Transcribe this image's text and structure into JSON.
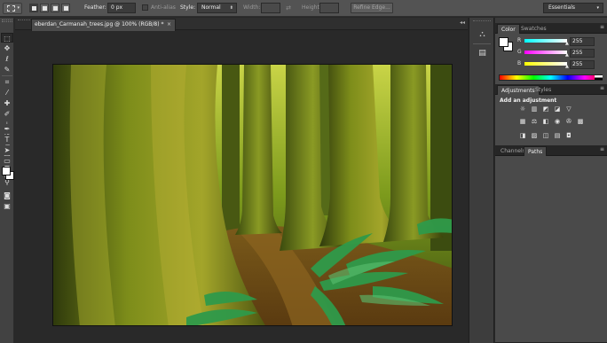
{
  "options_bar": {
    "feather_label": "Feather:",
    "feather_value": "0 px",
    "antialias_label": "Anti-alias",
    "style_label": "Style:",
    "style_value": "Normal",
    "width_label": "Width:",
    "height_label": "Height:",
    "refine_edge_label": "Refine Edge...",
    "workspace_value": "Essentials"
  },
  "document": {
    "tab_title": "eberdan_Carmanah_trees.jpg @ 100% (RGB/8) *",
    "tab_close": "×"
  },
  "color_panel": {
    "tabs": [
      "Color",
      "Swatches"
    ],
    "channels": [
      {
        "label": "R",
        "value": "255"
      },
      {
        "label": "G",
        "value": "255"
      },
      {
        "label": "B",
        "value": "255"
      }
    ],
    "foreground_color": "#ffffff",
    "background_color": "#ffffff"
  },
  "adjustments_panel": {
    "tabs": [
      "Adjustments",
      "Styles"
    ],
    "title": "Add an adjustment",
    "icons_row1": [
      "brightness-contrast-icon",
      "levels-icon",
      "curves-icon",
      "exposure-icon",
      "vibrance-icon",
      "gradient-triangle-icon"
    ],
    "icons_row2": [
      "hue-saturation-icon",
      "color-balance-icon",
      "black-white-icon",
      "photo-filter-icon",
      "channel-mixer-icon",
      "color-lookup-icon"
    ],
    "icons_row3": [
      "invert-icon",
      "posterize-icon",
      "threshold-icon",
      "gradient-map-icon",
      "selective-color-icon"
    ]
  },
  "paths_panel": {
    "tabs": [
      "Channels",
      "Paths"
    ]
  },
  "tools": [
    "rectangular-marquee-icon",
    "move-icon",
    "lasso-icon",
    "quick-selection-icon",
    "crop-icon",
    "eyedropper-icon",
    "spot-healing-icon",
    "brush-icon",
    "clone-stamp-icon",
    "history-brush-icon",
    "eraser-icon",
    "gradient-icon",
    "blur-icon",
    "dodge-icon",
    "pen-icon",
    "type-icon",
    "path-selection-icon",
    "rectangle-shape-icon",
    "hand-icon",
    "zoom-icon"
  ],
  "colors": {
    "ui_dark": "#282828",
    "panel": "#4a4a4a",
    "options_bar": "#535353"
  }
}
